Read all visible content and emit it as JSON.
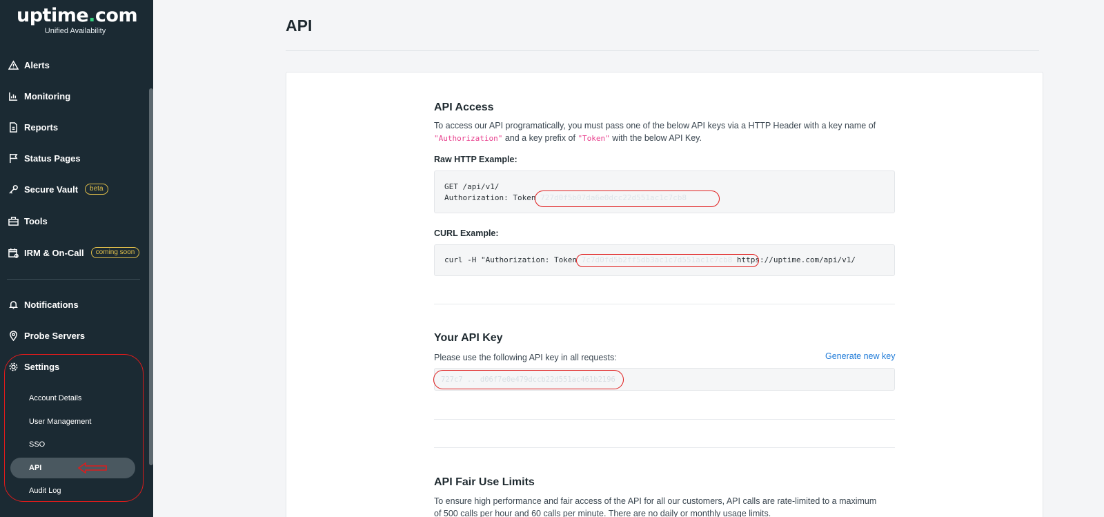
{
  "brand": {
    "name_prefix": "uptime",
    "name_dot": ".",
    "name_suffix": "com",
    "tagline": "Unified Availability"
  },
  "sidebar": {
    "items": [
      {
        "label": "Alerts",
        "icon": "alert-triangle-icon"
      },
      {
        "label": "Monitoring",
        "icon": "chart-icon"
      },
      {
        "label": "Reports",
        "icon": "report-icon"
      },
      {
        "label": "Status Pages",
        "icon": "flag-icon"
      },
      {
        "label": "Secure Vault",
        "icon": "key-icon",
        "badge": "beta"
      },
      {
        "label": "Tools",
        "icon": "toolbox-icon"
      },
      {
        "label": "IRM & On-Call",
        "icon": "calendar-icon",
        "badge": "coming soon"
      },
      {
        "label": "Notifications",
        "icon": "bell-icon"
      },
      {
        "label": "Probe Servers",
        "icon": "map-pin-icon"
      },
      {
        "label": "Settings",
        "icon": "gear-icon"
      }
    ],
    "settings_sub": [
      "Account Details",
      "User Management",
      "SSO",
      "API",
      "Audit Log"
    ],
    "active_sub": "API",
    "badge_color": "#e4c14a",
    "annotation_color": "#e01b1b"
  },
  "page": {
    "title": "API"
  },
  "api_access": {
    "heading": "API Access",
    "intro_1": "To access our API programatically, you must pass one of the below API keys via a HTTP Header with a key name of",
    "auth_header": "\"Authorization\"",
    "intro_2": " and a key prefix of ",
    "token_prefix": "\"Token\"",
    "intro_3": " with the below API Key.",
    "raw_label": "Raw HTTP Example:",
    "raw_line1": "GET /api/v1/",
    "raw_line2": "Authorization: Token ",
    "raw_token": "727d0f5b07da6e0dcc22d551ac1c7cb8",
    "curl_label": "CURL Example:",
    "curl_prefix": "curl -H \"Authorization: Token ",
    "curl_token": "7c7d0fd5b2ff5db3ac1c7d551ac1c7cb8",
    "curl_suffix": " https://uptime.com/api/v1/"
  },
  "your_key": {
    "heading": "Your API Key",
    "desc": "Please use the following API key in all requests:",
    "generate": "Generate new key",
    "key_value": "727c7 ..  d06f7e0e479dccb22d551ac461b2196"
  },
  "fair_use": {
    "heading": "API Fair Use Limits",
    "line1": "To ensure high performance and fair access of the API for all our customers, API calls are rate-limited to a maximum",
    "line2": "of 500 calls per hour and 60 calls per minute. There are no daily or monthly usage limits."
  }
}
